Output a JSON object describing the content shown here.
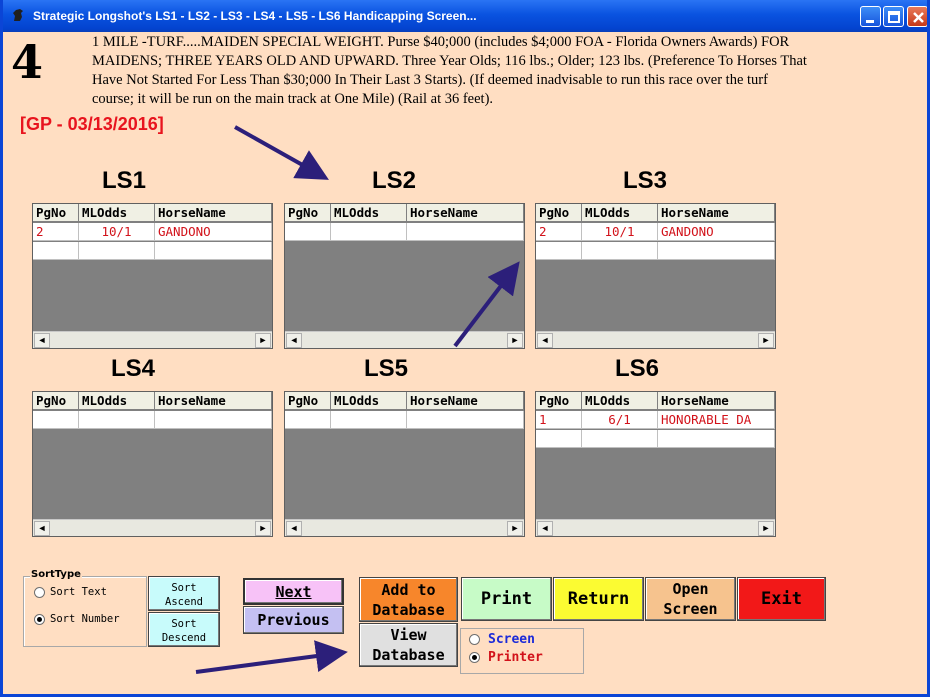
{
  "window": {
    "title": "Strategic Longshot's LS1 - LS2 - LS3 - LS4 - LS5 - LS6 Handicapping Screen...",
    "titlebar_color": "#0a53e0"
  },
  "race": {
    "number": "4",
    "description": "1 MILE -TURF.....MAIDEN SPECIAL WEIGHT. Purse $40;000 (includes $4;000 FOA - Florida Owners Awards) FOR MAIDENS; THREE YEARS OLD AND UPWARD. Three Year Olds; 116 lbs.; Older; 123 lbs. (Preference To Horses That Have Not Started For Less Than $30;000 In Their Last 3 Starts). (If deemed inadvisable to run this race over the turf course; it will be run on the main track at One Mile) (Rail at 36 feet).",
    "track_date": "[GP - 03/13/2016]"
  },
  "grid_columns": [
    "PgNo",
    "MLOdds",
    "HorseName"
  ],
  "lists": [
    {
      "label": "LS1",
      "rows": [
        {
          "pgno": "2",
          "odds": "10/1",
          "horse": "GANDONO"
        }
      ]
    },
    {
      "label": "LS2",
      "rows": []
    },
    {
      "label": "LS3",
      "rows": [
        {
          "pgno": "2",
          "odds": "10/1",
          "horse": "GANDONO"
        }
      ]
    },
    {
      "label": "LS4",
      "rows": []
    },
    {
      "label": "LS5",
      "rows": []
    },
    {
      "label": "LS6",
      "rows": [
        {
          "pgno": "1",
          "odds": "6/1",
          "horse": "HONORABLE DA"
        }
      ]
    }
  ],
  "sort_type": {
    "legend": "SortType",
    "options": [
      "Sort Text",
      "Sort Number"
    ],
    "selected": "Sort Number",
    "ascend_label": [
      "Sort",
      "Ascend"
    ],
    "descend_label": [
      "Sort",
      "Descend"
    ]
  },
  "buttons": {
    "next": "Next",
    "previous": "Previous",
    "add_to_database": [
      "Add to",
      "Database"
    ],
    "view_database": [
      "View",
      "Database"
    ],
    "print": "Print",
    "return": "Return",
    "open_screen": [
      "Open",
      "Screen"
    ],
    "exit": "Exit"
  },
  "output": {
    "options": [
      "Screen",
      "Printer"
    ],
    "selected": "Printer"
  },
  "colors": {
    "background": "#ffdec2",
    "highlight_text": "#d2121a",
    "annotation_arrow": "#2c1f7a"
  }
}
